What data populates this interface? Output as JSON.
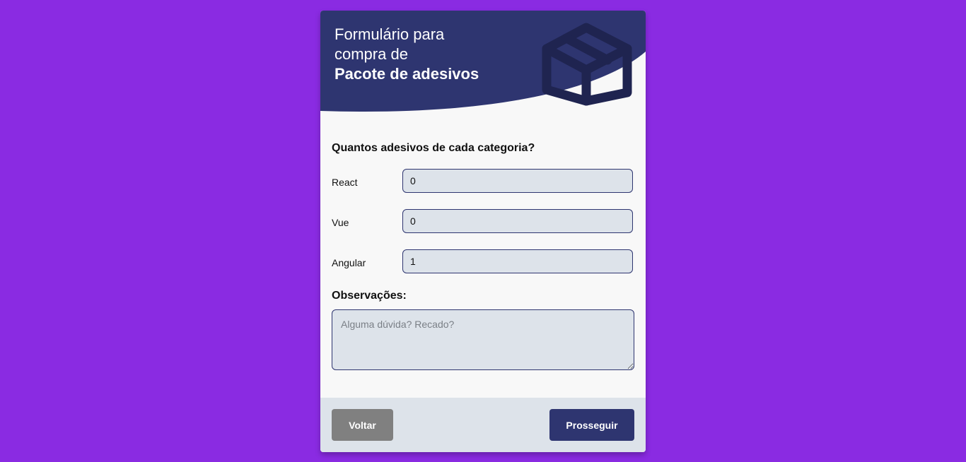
{
  "header": {
    "title_line1": "Formulário para",
    "title_line2": "compra de",
    "title_strong": "Pacote de adesivos",
    "icon": "package-box-icon"
  },
  "form": {
    "question": "Quantos adesivos de cada categoria?",
    "fields": [
      {
        "label": "React",
        "value": "0"
      },
      {
        "label": "Vue",
        "value": "0"
      },
      {
        "label": "Angular",
        "value": "1"
      }
    ],
    "notes_label": "Observações:",
    "notes_placeholder": "Alguma dúvida? Recado?",
    "notes_value": ""
  },
  "footer": {
    "back_label": "Voltar",
    "next_label": "Prosseguir"
  },
  "colors": {
    "page_background": "#8a2be2",
    "header_background": "#2e3570",
    "card_background": "#f8f8f8",
    "input_background": "#dde3ea",
    "back_button": "#808080",
    "next_button": "#2e3570"
  }
}
